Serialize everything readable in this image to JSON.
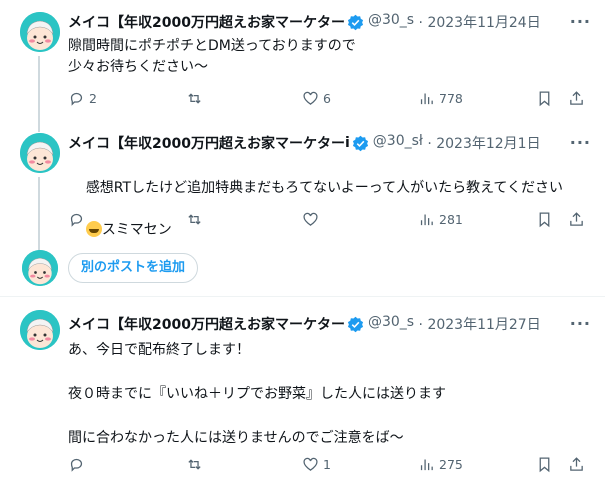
{
  "tweets": [
    {
      "name": "メイコ【年収2000万円超えお家マーケター",
      "handle": "@30_s",
      "separator": "·",
      "date": "2023年11月24日",
      "text": "隙間時間にポチポチとDM送っておりますので\n少々お待ちください〜",
      "replies": "2",
      "retweets": "",
      "likes": "6",
      "views": "778"
    },
    {
      "name": "メイコ【年収2000万円超えお家マーケター",
      "name_tail": "i",
      "handle": "@30_sł",
      "separator": "·",
      "date": "2023年12月1日",
      "text": "感想RTしたけど追加特典まだもろてないよーって人がいたら教えてください",
      "text_line2": "スミマセン",
      "replies": "",
      "retweets": "",
      "likes": "",
      "views": "281"
    },
    {
      "name": "メイコ【年収2000万円超えお家マーケター",
      "handle": "@30_s",
      "separator": "·",
      "date": "2023年11月27日",
      "text": "あ、今日で配布終了します！\n\n夜０時までに『いいね＋リプでお野菜』した人には送ります\n\n間に合わなかった人には送りませんのでご注意をば〜",
      "replies": "",
      "retweets": "",
      "likes": "1",
      "views": "275"
    }
  ],
  "add_post_label": "別のポストを追加",
  "more_label": "···",
  "colors": {
    "text": "#0f1419",
    "secondary": "#536471",
    "accent": "#1d9bf0",
    "verified": "#1d9bf0",
    "avatar_bg": "#2bc4c4"
  },
  "icons": [
    "reply-icon",
    "retweet-icon",
    "like-icon",
    "views-icon",
    "bookmark-icon",
    "share-icon",
    "verified-icon",
    "more-icon"
  ]
}
